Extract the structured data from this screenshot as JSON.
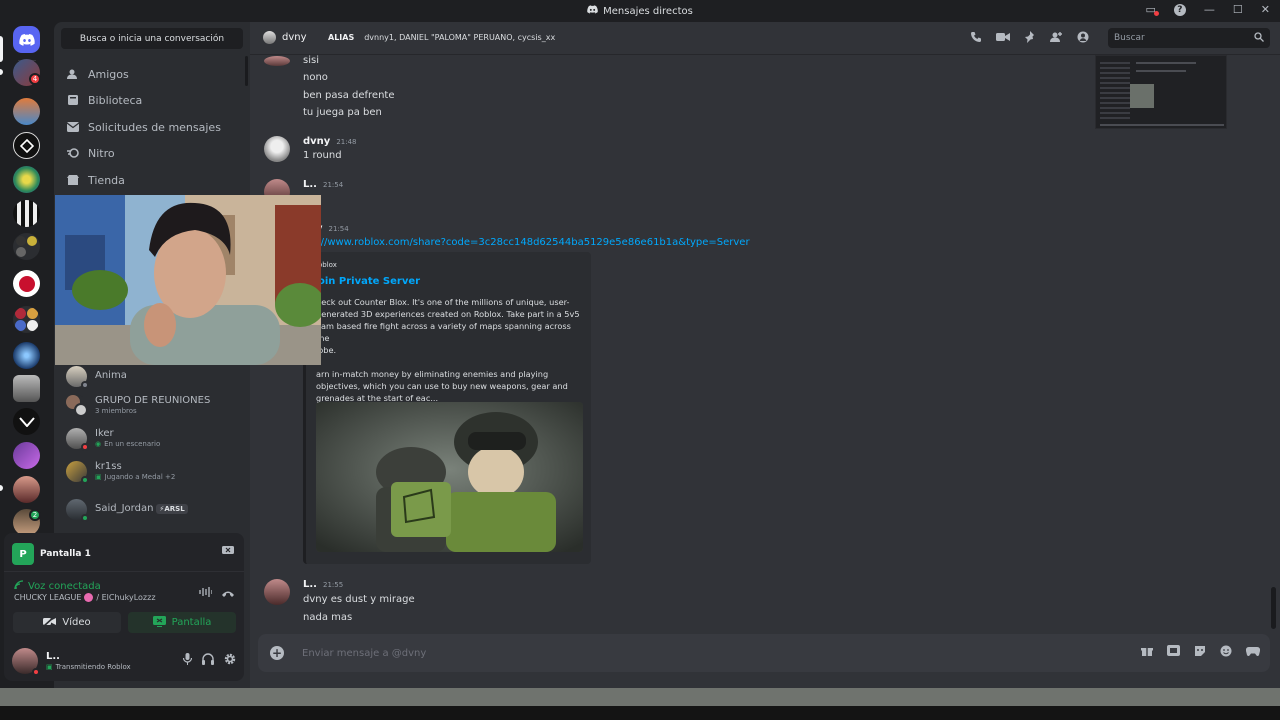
{
  "window": {
    "title": "Mensajes directos"
  },
  "colors": {
    "accent": "#5865f2",
    "green": "#23a559",
    "red": "#f23f43",
    "link": "#00a8fc"
  },
  "rail": {
    "badge_count": "4",
    "badge_count_2": "2"
  },
  "sidebar": {
    "search_label": "Busca o inicia una conversación",
    "nav": [
      {
        "label": "Amigos",
        "icon": "friends-icon"
      },
      {
        "label": "Biblioteca",
        "icon": "library-icon"
      },
      {
        "label": "Solicitudes de mensajes",
        "icon": "mail-icon"
      },
      {
        "label": "Nitro",
        "icon": "nitro-icon"
      },
      {
        "label": "Tienda",
        "icon": "shop-icon"
      }
    ],
    "dms": [
      {
        "name": "Anima",
        "sub": ""
      },
      {
        "name": "GRUPO DE REUNIONES",
        "sub": "3 miembros"
      },
      {
        "name": "Iker",
        "sub": "En un escenario"
      },
      {
        "name": "kr1ss",
        "sub": "Jugando a Medal +2"
      },
      {
        "name": "Said_Jordan",
        "sub": "",
        "tag": "ARSL"
      }
    ]
  },
  "voice": {
    "stream_title": "Pantalla 1",
    "status": "Voz conectada",
    "server": "CHUCKY LEAGUE",
    "channel": "/ ElChukyLozzz",
    "video_label": "Vídeo",
    "screen_label": "Pantalla"
  },
  "user": {
    "name": "L..",
    "status": "Transmitiendo Roblox"
  },
  "header": {
    "dm_name": "dvny",
    "alias_label": "ALIAS",
    "alias_value": "dvnny1, DANIEL \"PALOMA\" PERUANO, cycsis_xx",
    "search_placeholder": "Buscar"
  },
  "messages": {
    "block1": [
      "sisi",
      "nono",
      "ben pasa defrente",
      "tu juega pa ben"
    ],
    "m2": {
      "author": "dvny",
      "time": "21:48",
      "text": "1 round"
    },
    "m3": {
      "author": "L..",
      "time": "21:54"
    },
    "m4": {
      "author_fragment": "y",
      "time": "21:54",
      "text": "s://www.roblox.com/share?code=3c28cc148d62544ba5129e5e86e61b1a&type=Server"
    },
    "m5": {
      "author": "L..",
      "time": "21:55",
      "lines": [
        "dvny es dust y mirage",
        "nada mas"
      ]
    }
  },
  "embed": {
    "provider": "oblox",
    "title": "oin Private Server",
    "description": "heck out Counter Blox. It's one of the millions of unique, user-\ngenerated 3D experiences created on Roblox. Take part in a 5v5\neam based fire fight across a variety of maps spanning across the\nlobe.\n\narn in-match money by eliminating enemies and playing\nobjectives, which you can use to buy new weapons, gear and\ngrenades at the start of eac..."
  },
  "composer": {
    "placeholder": "Enviar mensaje a @dvny"
  }
}
